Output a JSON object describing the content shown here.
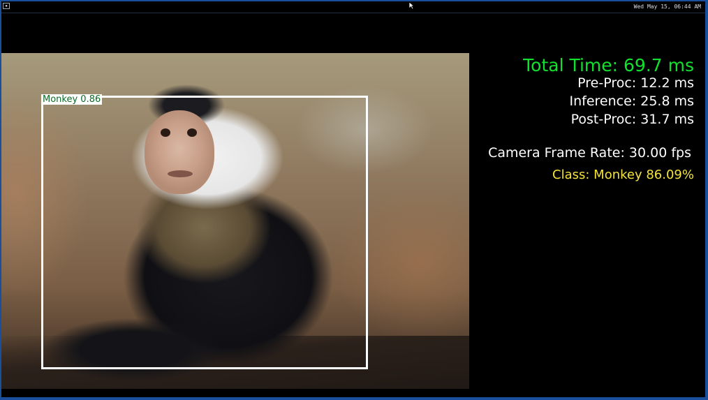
{
  "topbar": {
    "menu_icon": "menu-square-icon",
    "clock": "Wed May 15, 06:44 AM"
  },
  "detection": {
    "label": "Monkey 0.86"
  },
  "stats": {
    "total_time": "Total Time: 69.7 ms",
    "pre_proc": "Pre-Proc: 12.2 ms",
    "inference": "Inference: 25.8 ms",
    "post_proc": "Post-Proc: 31.7 ms",
    "camera_fps": "Camera Frame Rate: 30.00 fps",
    "class_result": "Class: Monkey 86.09%"
  },
  "colors": {
    "total_time": "#12e02f",
    "class_result": "#f3e33a",
    "stats_text": "#ffffff",
    "frame_border": "#1a4f9c"
  }
}
